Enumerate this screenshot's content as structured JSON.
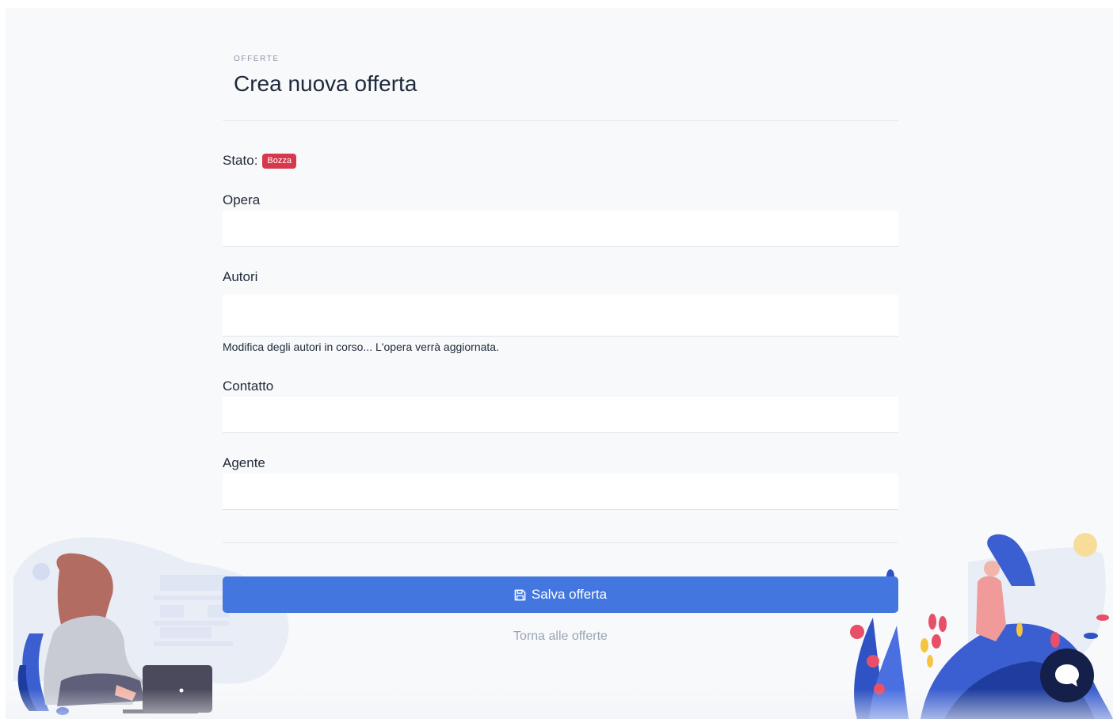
{
  "header": {
    "eyebrow": "OFFERTE",
    "title": "Crea nuova offerta"
  },
  "status": {
    "label": "Stato:",
    "badge": "Bozza",
    "badge_color": "#d6394b"
  },
  "form": {
    "fields": [
      {
        "label": "Opera",
        "value": ""
      },
      {
        "label": "Autori",
        "value": ""
      },
      {
        "label": "Contatto",
        "value": ""
      },
      {
        "label": "Agente",
        "value": ""
      }
    ],
    "autori_help": "Modifica degli autori in corso... L'opera verrà aggiornata."
  },
  "actions": {
    "save_label": "Salva offerta",
    "save_icon": "floppy-disk-icon",
    "save_color": "#4377df",
    "back_label": "Torna alle offerte"
  },
  "chat": {
    "icon": "chat-bubble-icon",
    "color": "#14204a"
  }
}
